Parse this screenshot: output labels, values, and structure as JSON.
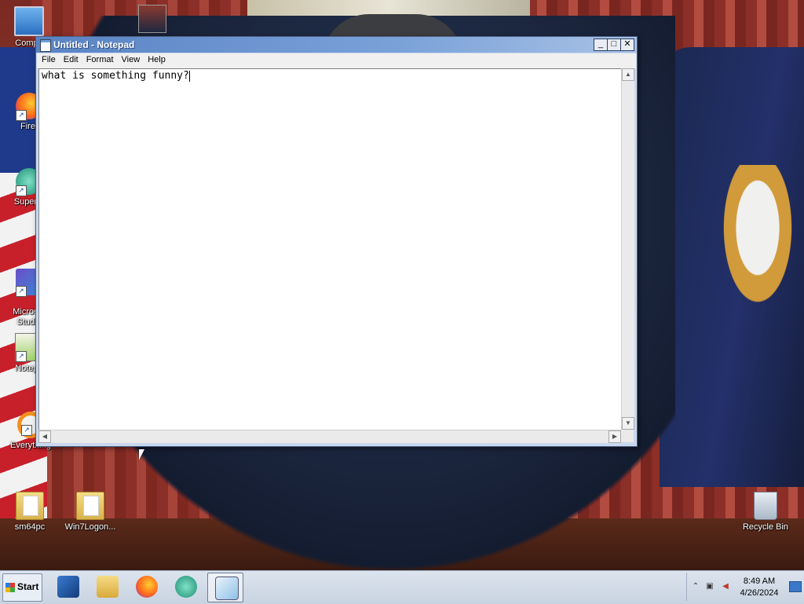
{
  "desktop": {
    "icons": [
      {
        "label": "Compu",
        "icon": "computer-icon"
      },
      {
        "label": "Firef",
        "icon": "firefox-icon"
      },
      {
        "label": "Superm",
        "icon": "supermium-icon"
      },
      {
        "label": "Microsof\nStudio",
        "icon": "visual-studio-icon"
      },
      {
        "label": "Notepa",
        "icon": "notepad-plus-icon"
      },
      {
        "label": "Everything",
        "icon": "everything-search-icon"
      },
      {
        "label": "sm64pc",
        "icon": "folder-icon"
      },
      {
        "label": "Win7Logon...",
        "icon": "folder-icon"
      },
      {
        "label": "Recycle Bin",
        "icon": "recycle-bin-icon"
      }
    ]
  },
  "notepad": {
    "title": "Untitled - Notepad",
    "menu": [
      "File",
      "Edit",
      "Format",
      "View",
      "Help"
    ],
    "content": "what is something funny?",
    "buttons": {
      "minimize": "_",
      "maximize": "□",
      "close": "✕"
    }
  },
  "taskbar": {
    "start_label": "Start",
    "apps": [
      "powershell-icon",
      "file-explorer-icon",
      "firefox-icon",
      "supermium-icon",
      "notepad-icon"
    ],
    "clock_time": "8:49 AM",
    "clock_date": "4/26/2024"
  }
}
